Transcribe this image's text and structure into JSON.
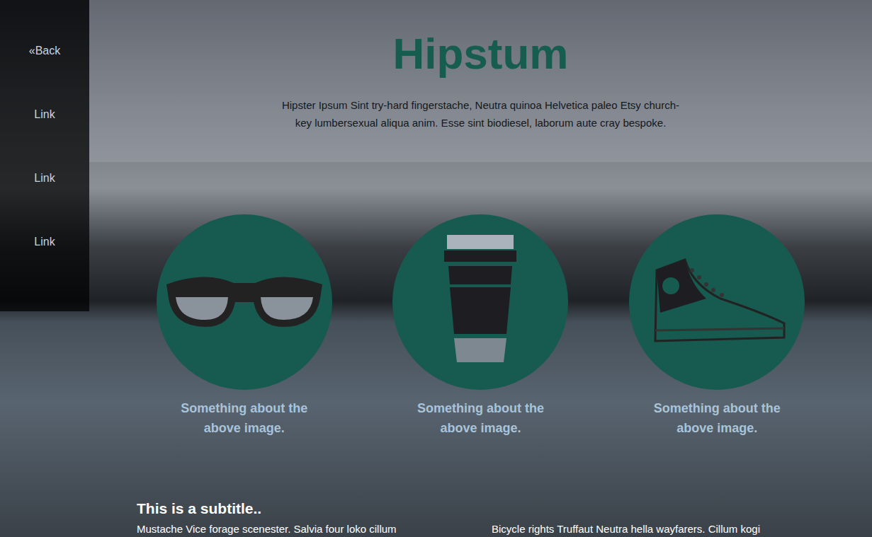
{
  "sidebar": {
    "links": [
      {
        "label": "«Back"
      },
      {
        "label": "Link"
      },
      {
        "label": "Link"
      },
      {
        "label": "Link"
      }
    ]
  },
  "header": {
    "title": "Hipstum",
    "intro": "Hipster Ipsum Sint try-hard fingerstache, Neutra quinoa Helvetica paleo Etsy church-key lumbersexual aliqua anim. Esse sint biodiesel, laborum aute cray bespoke."
  },
  "features": [
    {
      "caption": "Something about the above image."
    },
    {
      "caption": "Something about the above image."
    },
    {
      "caption": "Something about the above image."
    }
  ],
  "section": {
    "subtitle": "This is a subtitle..",
    "columns": [
      "Mustache Vice forage scenester. Salvia four loko cillum",
      "Bicycle rights Truffaut Neutra hella wayfarers. Cillum kogi"
    ]
  }
}
